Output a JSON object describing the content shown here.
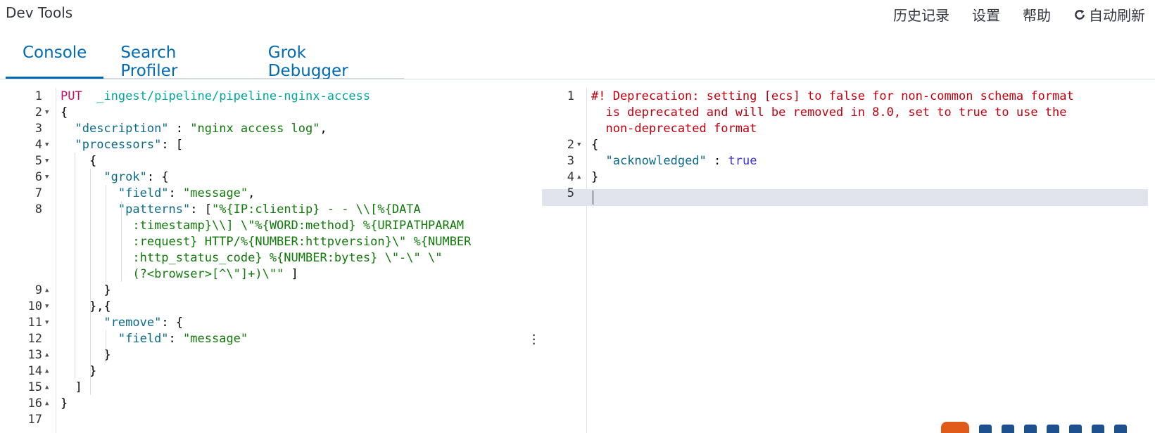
{
  "app": {
    "title": "Dev Tools"
  },
  "top_actions": {
    "history": "历史记录",
    "settings": "设置",
    "help": "帮助",
    "auto_refresh": "自动刷新"
  },
  "tabs": [
    {
      "label": "Console",
      "active": true
    },
    {
      "label": "Search Profiler",
      "active": false
    },
    {
      "label": "Grok Debugger",
      "active": false
    }
  ],
  "request_editor": {
    "lines": [
      {
        "num": "1",
        "fold": "",
        "segments": [
          [
            "c-method",
            "PUT"
          ],
          [
            "",
            "  "
          ],
          [
            "c-url",
            "_ingest/pipeline/pipeline-nginx-access"
          ]
        ]
      },
      {
        "num": "2",
        "fold": "down",
        "segments": [
          [
            "",
            "{"
          ]
        ]
      },
      {
        "num": "3",
        "fold": "",
        "segments": [
          [
            "",
            "  "
          ],
          [
            "c-key",
            "\"description\""
          ],
          [
            "",
            " : "
          ],
          [
            "c-str",
            "\"nginx access log\""
          ],
          [
            "",
            ","
          ]
        ]
      },
      {
        "num": "4",
        "fold": "down",
        "segments": [
          [
            "",
            "  "
          ],
          [
            "c-key",
            "\"processors\""
          ],
          [
            "",
            ": ["
          ]
        ]
      },
      {
        "num": "5",
        "fold": "down",
        "segments": [
          [
            "",
            "    {"
          ]
        ]
      },
      {
        "num": "6",
        "fold": "down",
        "segments": [
          [
            "",
            "      "
          ],
          [
            "c-key",
            "\"grok\""
          ],
          [
            "",
            ": {"
          ]
        ]
      },
      {
        "num": "7",
        "fold": "",
        "segments": [
          [
            "",
            "        "
          ],
          [
            "c-key",
            "\"field\""
          ],
          [
            "",
            ": "
          ],
          [
            "c-str",
            "\"message\""
          ],
          [
            "",
            ","
          ]
        ]
      },
      {
        "num": "8",
        "fold": "",
        "segments": [
          [
            "",
            "        "
          ],
          [
            "c-key",
            "\"patterns\""
          ],
          [
            "",
            ": ["
          ],
          [
            "c-str",
            "\"%{IP:clientip} - - \\\\[%{DATA"
          ]
        ]
      },
      {
        "num": "",
        "fold": "",
        "segments": [
          [
            "",
            "          "
          ],
          [
            "c-str",
            ":timestamp}\\\\] \\\"%{WORD:method} %{URIPATHPARAM"
          ]
        ]
      },
      {
        "num": "",
        "fold": "",
        "segments": [
          [
            "",
            "          "
          ],
          [
            "c-str",
            ":request} HTTP/%{NUMBER:httpversion}\\\" %{NUMBER"
          ]
        ]
      },
      {
        "num": "",
        "fold": "",
        "segments": [
          [
            "",
            "          "
          ],
          [
            "c-str",
            ":http_status_code} %{NUMBER:bytes} \\\"-\\\" \\\""
          ]
        ]
      },
      {
        "num": "",
        "fold": "",
        "segments": [
          [
            "",
            "          "
          ],
          [
            "c-str",
            "(?<browser>[^\\\"]+)\\\"\""
          ],
          [
            "",
            " ]"
          ]
        ]
      },
      {
        "num": "9",
        "fold": "up",
        "segments": [
          [
            "",
            "      }"
          ]
        ]
      },
      {
        "num": "10",
        "fold": "down",
        "segments": [
          [
            "",
            "    },{"
          ]
        ]
      },
      {
        "num": "11",
        "fold": "down",
        "segments": [
          [
            "",
            "      "
          ],
          [
            "c-key",
            "\"remove\""
          ],
          [
            "",
            ": {"
          ]
        ]
      },
      {
        "num": "12",
        "fold": "",
        "segments": [
          [
            "",
            "        "
          ],
          [
            "c-key",
            "\"field\""
          ],
          [
            "",
            ": "
          ],
          [
            "c-str",
            "\"message\""
          ]
        ]
      },
      {
        "num": "13",
        "fold": "up",
        "segments": [
          [
            "",
            "      }"
          ]
        ]
      },
      {
        "num": "14",
        "fold": "up",
        "segments": [
          [
            "",
            "    }"
          ]
        ]
      },
      {
        "num": "15",
        "fold": "up",
        "segments": [
          [
            "",
            "  ]"
          ]
        ]
      },
      {
        "num": "16",
        "fold": "up",
        "segments": [
          [
            "",
            "}"
          ]
        ]
      },
      {
        "num": "17",
        "fold": "",
        "segments": []
      }
    ]
  },
  "response_editor": {
    "lines": [
      {
        "num": "1",
        "fold": "",
        "segments": [
          [
            "c-warn",
            "#! Deprecation: setting [ecs] to false for non-common schema format"
          ]
        ]
      },
      {
        "num": "",
        "fold": "",
        "segments": [
          [
            "c-warn",
            "  is deprecated and will be removed in 8.0, set to true to use the"
          ]
        ]
      },
      {
        "num": "",
        "fold": "",
        "segments": [
          [
            "c-warn",
            "  non-deprecated format"
          ]
        ]
      },
      {
        "num": "2",
        "fold": "down",
        "segments": [
          [
            "",
            "{"
          ]
        ]
      },
      {
        "num": "3",
        "fold": "",
        "segments": [
          [
            "",
            "  "
          ],
          [
            "c-key",
            "\"acknowledged\""
          ],
          [
            "",
            " : "
          ],
          [
            "c-bool",
            "true"
          ]
        ]
      },
      {
        "num": "4",
        "fold": "up",
        "segments": [
          [
            "",
            "}"
          ]
        ]
      },
      {
        "num": "5",
        "fold": "",
        "segments": []
      }
    ]
  },
  "colors": {
    "accent": "#006bb4",
    "method": "#c80a68",
    "url": "#00a69b",
    "warning": "#c0000f"
  }
}
